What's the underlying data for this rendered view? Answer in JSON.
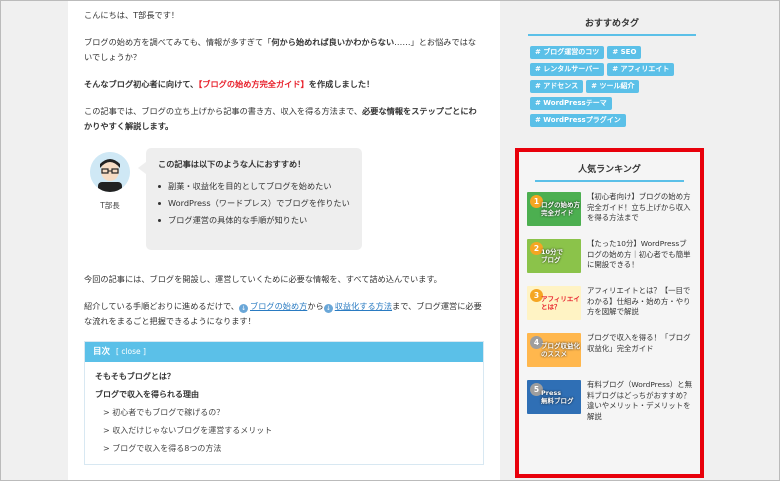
{
  "article": {
    "greeting": "こんにちは、T部長です！",
    "intro1_a": "ブログの始め方を調べてみても、情報が多すぎて「",
    "intro1_b": "何から始めれば良いかわからない",
    "intro1_c": "……」とお悩みではないでしょうか？",
    "intro2_a": "そんなブログ初心者に向けて、",
    "intro2_b": "【ブログの始め方完全ガイド】",
    "intro2_c": "を作成しました！",
    "intro3_a": "この記事では、ブログの立ち上げから記事の書き方、収入を得る方法まで、",
    "intro3_b": "必要な情報をステップごとにわかりやすく解説します。",
    "speech": {
      "name": "T部長",
      "title": "この記事は以下のような人におすすめ！",
      "items": [
        "副業・収益化を目的としてブログを始めたい",
        "WordPress（ワードプレス）でブログを作りたい",
        "ブログ運営の具体的な手順が知りたい"
      ]
    },
    "para4": "今回の記事には、ブログを開設し、運営していくために必要な情報を、すべて詰め込んでいます。",
    "para5_a": "紹介している手順どおりに進めるだけで、",
    "para5_link1": "ブログの始め方",
    "para5_b": "から",
    "para5_link2": "収益化する方法",
    "para5_c": "まで、ブログ運営に必要な流れをまるごと把握できるようになります！",
    "toc": {
      "title": "目次",
      "close": "[ close ]",
      "items": [
        {
          "level": 2,
          "text": "そもそもブログとは？"
        },
        {
          "level": 2,
          "text": "ブログで収入を得られる理由"
        },
        {
          "level": 3,
          "text": "> 初心者でもブログで稼げるの？"
        },
        {
          "level": 3,
          "text": "> 収入だけじゃないブログを運営するメリット"
        },
        {
          "level": 3,
          "text": "> ブログで収入を得る8つの方法"
        }
      ]
    }
  },
  "sidebar": {
    "tags_title": "おすすめタグ",
    "tags": [
      "# ブログ運営のコツ",
      "# SEO",
      "# レンタルサーバー",
      "# アフィリエイト",
      "# アドセンス",
      "# ツール紹介",
      "# WordPressテーマ",
      "# WordPressプラグイン"
    ],
    "ranking_title": "人気ランキング",
    "ranking": [
      {
        "num": "1",
        "thumb": "ログの始め方\n完全ガイド",
        "text": "【初心者向け】ブログの始め方完全ガイド！立ち上げから収入を得る方法まで",
        "color": "#4caf50",
        "badge": "#f5a623"
      },
      {
        "num": "2",
        "thumb": "10分で\nブログ",
        "text": "【たった10分】WordPressブログの始め方｜初心者でも簡単に開設できる！",
        "color": "#8bc34a",
        "badge": "#f5a623"
      },
      {
        "num": "3",
        "thumb": "アフィリエイト\nとは？",
        "text": "アフィリエイトとは？【一目でわかる】仕組み・始め方・やり方を図解で解説",
        "color": "#fff3c4",
        "badge": "#f5a623"
      },
      {
        "num": "4",
        "thumb": "ブログ収益化\nのススメ",
        "text": "ブログで収入を得る！「ブログ収益化」完全ガイド",
        "color": "#ffb74d",
        "badge": "#9e9e9e"
      },
      {
        "num": "5",
        "thumb": "Press\n無料ブログ",
        "text": "有料ブログ（WordPress）と無料ブログはどっちがおすすめ？違いやメリット・デメリットを解説",
        "color": "#2f6fb5",
        "badge": "#9e9e9e"
      }
    ]
  }
}
